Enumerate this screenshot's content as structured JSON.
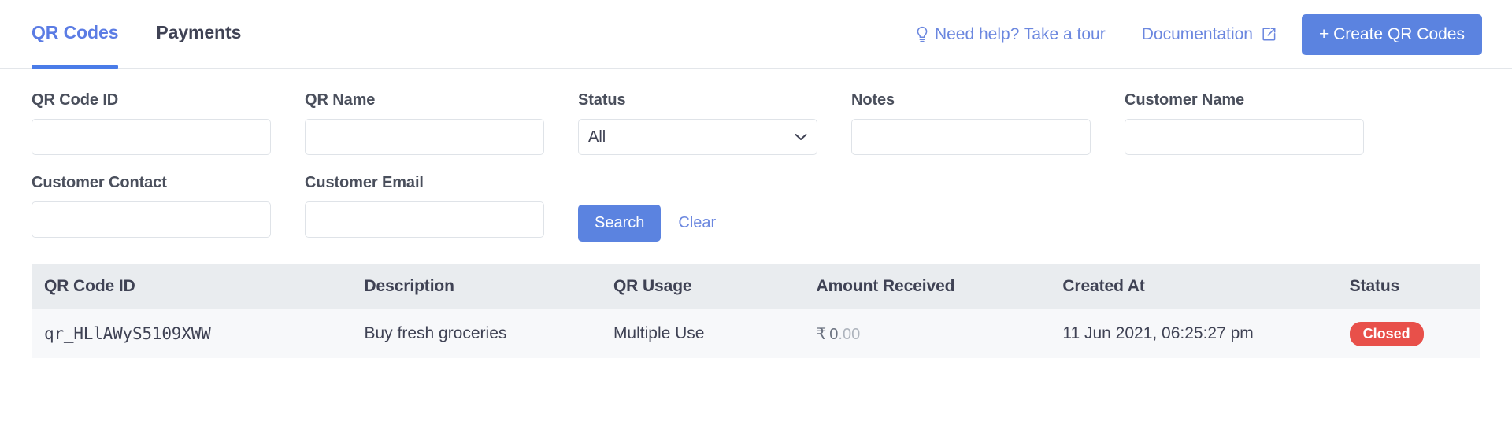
{
  "tabs": [
    {
      "label": "QR Codes",
      "active": true
    },
    {
      "label": "Payments",
      "active": false
    }
  ],
  "header": {
    "help_label": "Need help? Take a tour",
    "help_icon": "lightbulb-icon",
    "documentation_label": "Documentation",
    "documentation_icon": "external-link-icon",
    "create_button_label": "+ Create QR Codes",
    "accent_color": "#5b83e0",
    "link_color": "#6b87df"
  },
  "filters": {
    "qr_code_id": {
      "label": "QR Code ID",
      "value": "",
      "placeholder": ""
    },
    "qr_name": {
      "label": "QR Name",
      "value": "",
      "placeholder": ""
    },
    "status": {
      "label": "Status",
      "value": "All",
      "options": [
        "All"
      ]
    },
    "notes": {
      "label": "Notes",
      "value": "",
      "placeholder": ""
    },
    "customer_name": {
      "label": "Customer Name",
      "value": "",
      "placeholder": ""
    },
    "customer_contact": {
      "label": "Customer Contact",
      "value": "",
      "placeholder": ""
    },
    "customer_email": {
      "label": "Customer Email",
      "value": "",
      "placeholder": ""
    },
    "search_label": "Search",
    "clear_label": "Clear"
  },
  "table": {
    "columns": [
      "QR Code ID",
      "Description",
      "QR Usage",
      "Amount Received",
      "Created At",
      "Status"
    ],
    "rows": [
      {
        "qr_code_id": "qr_HLlAWyS5109XWW",
        "description": "Buy fresh groceries",
        "qr_usage": "Multiple Use",
        "amount_currency": "₹",
        "amount_int": "0",
        "amount_dec": ".00",
        "created_at": "11 Jun 2021, 06:25:27 pm",
        "status": "Closed",
        "status_color": "#e8504a"
      }
    ]
  }
}
